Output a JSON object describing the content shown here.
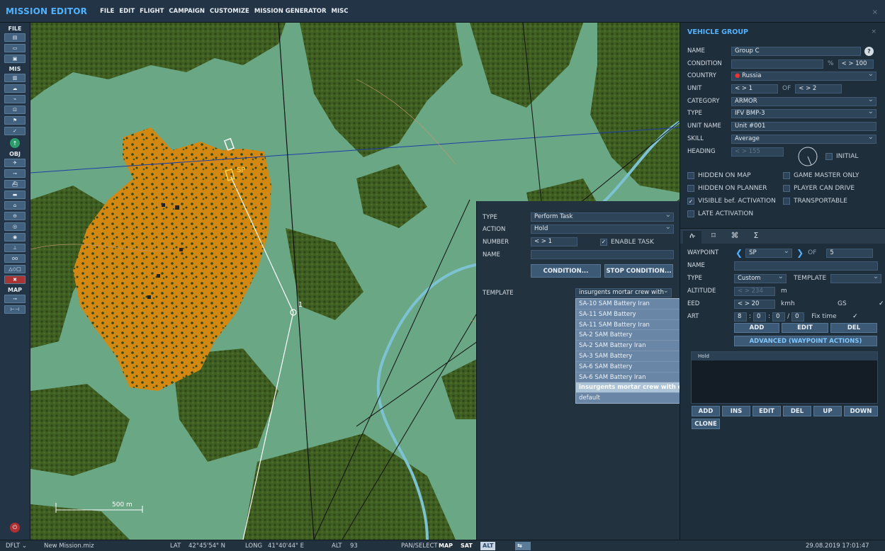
{
  "app": {
    "title": "MISSION EDITOR",
    "menu": [
      "FILE",
      "EDIT",
      "FLIGHT",
      "CAMPAIGN",
      "CUSTOMIZE",
      "MISSION GENERATOR",
      "MISC"
    ],
    "close_glyph": "×"
  },
  "toolbar": {
    "sections": {
      "file": "FILE",
      "mis": "MIS",
      "obj": "OBJ",
      "map": "MAP"
    }
  },
  "map": {
    "scale_label": "500 m",
    "start_label": "SP",
    "waypoint_label": "1"
  },
  "task_panel": {
    "type_label": "TYPE",
    "type_value": "Perform Task",
    "action_label": "ACTION",
    "action_value": "Hold",
    "number_label": "NUMBER",
    "number_value": "< > 1",
    "enable_task_label": "ENABLE TASK",
    "enable_task_checked": true,
    "name_label": "NAME",
    "name_value": "",
    "condition_button": "CONDITION...",
    "stop_condition_button": "STOP CONDITION...",
    "template_label": "TEMPLATE",
    "template_value": "insurgents mortar crew with",
    "template_options": [
      "SA-10 SAM Battery Iran",
      "SA-11 SAM Battery",
      "SA-11 SAM Battery Iran",
      "SA-2 SAM Battery",
      "SA-2 SAM Battery Iran",
      "SA-3 SAM Battery",
      "SA-6 SAM Battery",
      "SA-6 SAM Battery Iran",
      "insurgents mortar crew with car",
      "default"
    ],
    "template_selected_index": 8
  },
  "vehicle_group": {
    "title": "VEHICLE GROUP",
    "name_label": "NAME",
    "name_value": "Group C",
    "help_glyph": "?",
    "condition_label": "CONDITION",
    "condition_value": "",
    "condition_pct": "%",
    "condition_prob": "< > 100",
    "country_label": "COUNTRY",
    "country_value": "Russia",
    "unit_label": "UNIT",
    "unit_value": "< > 1",
    "unit_of": "OF",
    "unit_total": "< > 2",
    "category_label": "CATEGORY",
    "category_value": "ARMOR",
    "type_label": "TYPE",
    "type_value": "IFV BMP-3",
    "unit_name_label": "UNIT NAME",
    "unit_name_value": "Unit #001",
    "skill_label": "SKILL",
    "skill_value": "Average",
    "heading_label": "HEADING",
    "heading_value": "< > 155",
    "initial_label": "INITIAL",
    "checkboxes": [
      {
        "label": "HIDDEN ON MAP",
        "checked": false
      },
      {
        "label": "GAME MASTER ONLY",
        "checked": false
      },
      {
        "label": "HIDDEN ON PLANNER",
        "checked": false
      },
      {
        "label": "PLAYER CAN DRIVE",
        "checked": false
      },
      {
        "label": "VISIBLE bef. ACTIVATION",
        "checked": true
      },
      {
        "label": "TRANSPORTABLE",
        "checked": false
      },
      {
        "label": "LATE ACTIVATION",
        "checked": false
      }
    ],
    "tab_icons": [
      "route-icon",
      "target-icon",
      "triggers-icon",
      "summary-icon"
    ],
    "tab_glyphs": [
      "ሉ",
      "⌑",
      "⌘",
      "Σ"
    ]
  },
  "waypoint": {
    "label": "WAYPOINT",
    "value": "SP",
    "of_label": "OF",
    "total": "5",
    "name_label": "NAME",
    "name_value": "",
    "type_label": "TYPE",
    "type_value": "Custom",
    "template_label": "TEMPLATE",
    "template_value": "",
    "altitude_label": "ALTITUDE",
    "altitude_value": "< > 234",
    "altitude_unit": "m",
    "speed_label": "EED",
    "speed_value": "< > 20",
    "speed_unit": "kmh",
    "gs_label": "GS",
    "gs_checked": true,
    "start_label": "ART",
    "start_hh": "8",
    "start_mm": "0",
    "start_ss": "0",
    "start_day": "0",
    "fix_time_label": "Fix time",
    "fix_time_checked": true,
    "add_button": "ADD",
    "edit_button": "EDIT",
    "del_button": "DEL",
    "advanced_button": "ADVANCED (WAYPOINT ACTIONS)",
    "actions_list": [
      "Hold"
    ],
    "list_buttons": [
      "ADD",
      "INS",
      "EDIT",
      "DEL",
      "UP",
      "DOWN",
      "CLONE"
    ]
  },
  "status_bar": {
    "profile": "DFLT",
    "filename": "New Mission.miz",
    "lat_label": "LAT",
    "lat_value": "42°45'54\" N",
    "long_label": "LONG",
    "long_value": "41°40'44\" E",
    "alt_label": "ALT",
    "alt_value": "93",
    "mode": "PAN/SELECT",
    "map_btn": "MAP",
    "sat_btn": "SAT",
    "alt_btn": "ALT",
    "datetime": "29.08.2019 17:01:47"
  },
  "colors": {
    "accent_blue": "#4fb3ff",
    "map_green": "#6aa784",
    "zone_orange": "#d4880f",
    "forest": "#3b5a1e",
    "river": "#7cc2d3",
    "sp_yellow": "#ffd84a"
  }
}
